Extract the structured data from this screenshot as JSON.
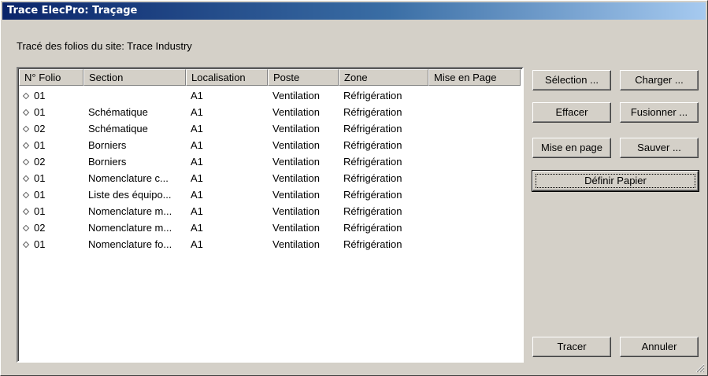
{
  "window": {
    "title": "Trace ElecPro: Traçage"
  },
  "subtitle": "Tracé des folios du site: Trace Industry",
  "list": {
    "columns": [
      "N° Folio",
      "Section",
      "Localisation",
      "Poste",
      "Zone",
      "Mise en Page"
    ],
    "rows": [
      {
        "folio": "01",
        "section": "",
        "localisation": "A1",
        "poste": "Ventilation",
        "zone": "Réfrigération",
        "mise": ""
      },
      {
        "folio": "01",
        "section": "Schématique",
        "localisation": "A1",
        "poste": "Ventilation",
        "zone": "Réfrigération",
        "mise": ""
      },
      {
        "folio": "02",
        "section": "Schématique",
        "localisation": "A1",
        "poste": "Ventilation",
        "zone": "Réfrigération",
        "mise": ""
      },
      {
        "folio": "01",
        "section": "Borniers",
        "localisation": "A1",
        "poste": "Ventilation",
        "zone": "Réfrigération",
        "mise": ""
      },
      {
        "folio": "02",
        "section": "Borniers",
        "localisation": "A1",
        "poste": "Ventilation",
        "zone": "Réfrigération",
        "mise": ""
      },
      {
        "folio": "01",
        "section": "Nomenclature c...",
        "localisation": "A1",
        "poste": "Ventilation",
        "zone": "Réfrigération",
        "mise": ""
      },
      {
        "folio": "01",
        "section": "Liste des équipo...",
        "localisation": "A1",
        "poste": "Ventilation",
        "zone": "Réfrigération",
        "mise": ""
      },
      {
        "folio": "01",
        "section": "Nomenclature m...",
        "localisation": "A1",
        "poste": "Ventilation",
        "zone": "Réfrigération",
        "mise": ""
      },
      {
        "folio": "02",
        "section": "Nomenclature m...",
        "localisation": "A1",
        "poste": "Ventilation",
        "zone": "Réfrigération",
        "mise": ""
      },
      {
        "folio": "01",
        "section": "Nomenclature fo...",
        "localisation": "A1",
        "poste": "Ventilation",
        "zone": "Réfrigération",
        "mise": ""
      }
    ]
  },
  "buttons": {
    "selection": "Sélection ...",
    "charger": "Charger ...",
    "effacer": "Effacer",
    "fusionner": "Fusionner ...",
    "mise_en_page": "Mise en page",
    "sauver": "Sauver ...",
    "definir_papier": "Définir Papier",
    "tracer": "Tracer",
    "annuler": "Annuler"
  }
}
